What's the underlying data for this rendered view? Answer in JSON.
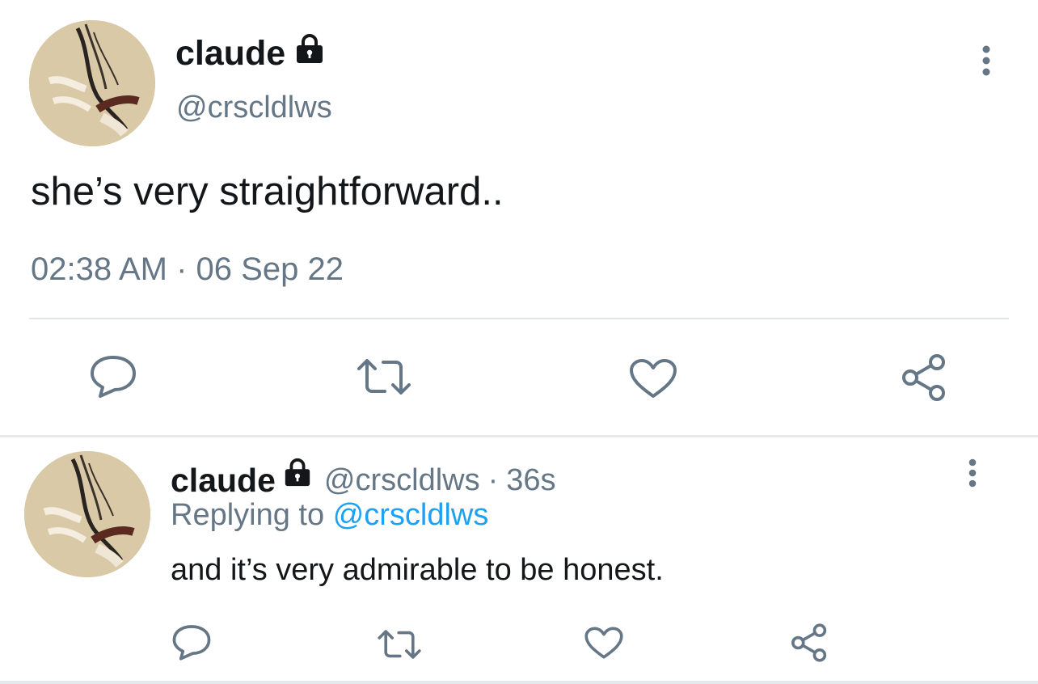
{
  "main_tweet": {
    "name": "claude",
    "handle": "@crscldlws",
    "text": "she’s very straightforward..",
    "timestamp": "02:38 AM · 06 Sep 22",
    "icons": {
      "lock": "lock-icon",
      "more": "more-vertical-icon",
      "reply": "reply-icon",
      "retweet": "retweet-icon",
      "like": "heart-icon",
      "share": "share-icon"
    }
  },
  "reply_tweet": {
    "name": "claude",
    "handle": "@crscldlws",
    "separator": "·",
    "age": "36s",
    "replying_prefix": "Replying to",
    "replying_handle": "@crscldlws",
    "text": "and it’s very admirable to be honest."
  },
  "colors": {
    "text_primary": "#14171a",
    "text_secondary": "#657786",
    "link": "#1da1f2",
    "icon": "#657786",
    "divider": "#e3e6e8"
  }
}
